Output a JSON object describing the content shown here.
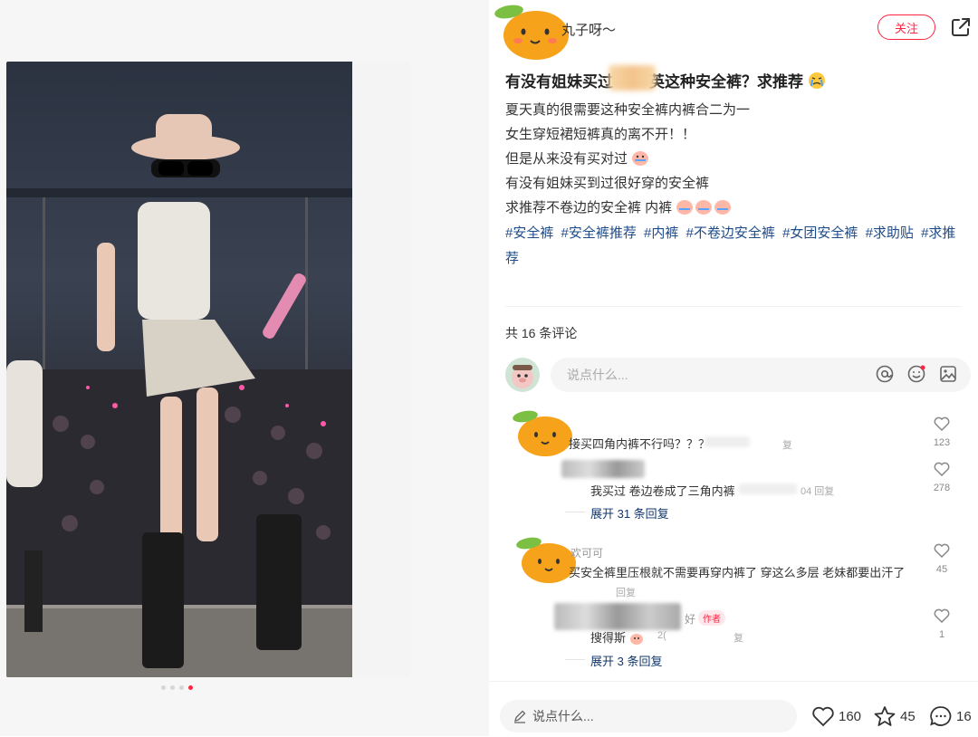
{
  "author": {
    "name": "丸子呀～",
    "follow_label": "关注"
  },
  "note": {
    "title": "有没有姐妹买过",
    "title_rest": "英这种安全裤？求推荐",
    "lines": [
      "夏天真的很需要这种安全裤内裤合二为一",
      "女生穿短裙短裤真的离不开！！",
      "但是从来没有买对过",
      "有没有姐妹买到过很好穿的安全裤",
      "求推荐不卷边的安全裤 内裤"
    ],
    "tags": [
      "#安全裤",
      "#安全裤推荐",
      "#内裤",
      "#不卷边安全裤",
      "#女团安全裤",
      "#求助贴",
      "#求推荐"
    ]
  },
  "comments_header": "共 16 条评论",
  "comment_input_placeholder": "说点什么...",
  "comments": [
    {
      "text": "接买四角内裤不行吗？？？",
      "reply_label": "复",
      "likes": "123",
      "replies": [
        {
          "text": "我买过 卷边卷成了三角内裤",
          "meta": "04 回复",
          "likes": "278"
        }
      ],
      "expand": "展开 31 条回复"
    },
    {
      "name": "欢可可",
      "text": "买安全裤里压根就不需要再穿内裤了 穿这么多层 老妹都要出汗了",
      "reply_label": "回复",
      "likes": "45",
      "replies": [
        {
          "name_tail": "好",
          "badge": "作者",
          "text": "搜得斯",
          "meta": "2(",
          "meta2": "复",
          "likes": "1"
        }
      ],
      "expand": "展开 3 条回复"
    }
  ],
  "bottom": {
    "placeholder": "说点什么...",
    "likes": "160",
    "collects": "45",
    "comments": "16"
  },
  "carousel": {
    "count": 4,
    "active": 3
  },
  "colors": {
    "accent": "#ff2442",
    "tag": "#13386c",
    "fruit": "#f7a21b",
    "leaf": "#7cc043"
  }
}
